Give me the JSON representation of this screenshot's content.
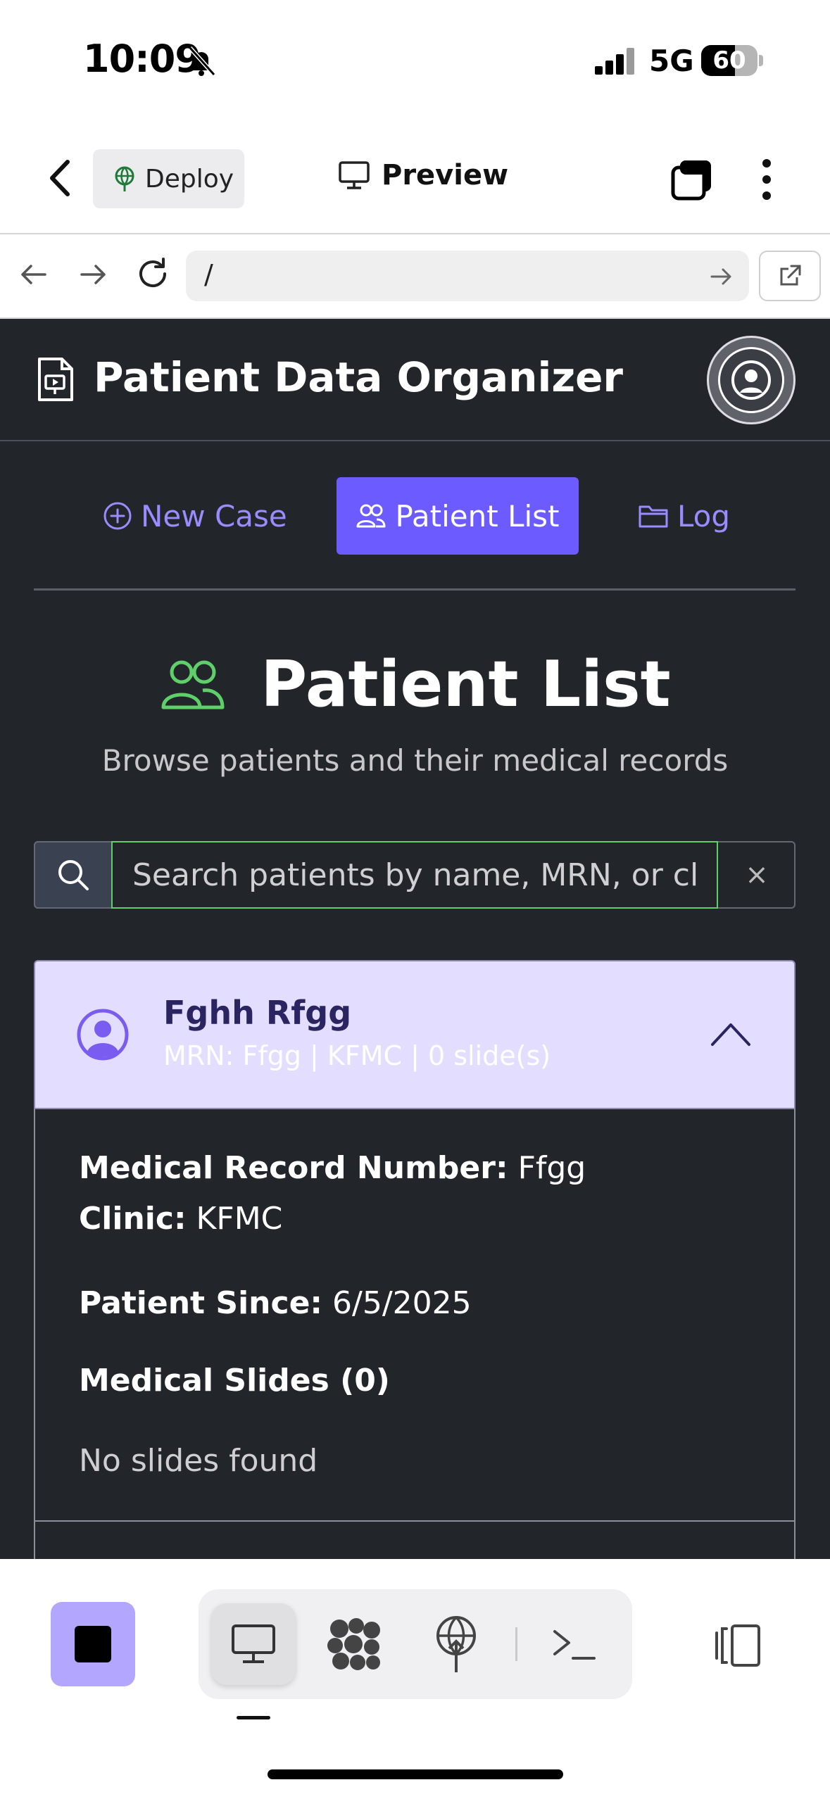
{
  "status_bar": {
    "time": "10:09",
    "network": "5G",
    "battery": "60",
    "battery_level": 0.6
  },
  "toolbar": {
    "deploy_label": "Deploy",
    "preview_label": "Preview"
  },
  "browser": {
    "url": "/"
  },
  "app": {
    "title": "Patient Data Organizer",
    "tabs": [
      {
        "label": "New Case",
        "icon": "plus-circle-icon"
      },
      {
        "label": "Patient List",
        "icon": "users-icon",
        "active": true
      },
      {
        "label": "Log",
        "icon": "folder-icon"
      }
    ],
    "page": {
      "title": "Patient List",
      "subtitle": "Browse patients and their medical records"
    },
    "search": {
      "placeholder": "Search patients by name, MRN, or clinic",
      "value": "",
      "clear_label": "×"
    },
    "patient": {
      "name": "Fghh Rfgg",
      "meta": "MRN: Ffgg | KFMC | 0 slide(s)",
      "mrn_label": "Medical Record Number:",
      "mrn_value": "Ffgg",
      "clinic_label": "Clinic:",
      "clinic_value": "KFMC",
      "since_label": "Patient Since:",
      "since_value": "6/5/2025",
      "slides_heading": "Medical Slides (0)",
      "slides_empty": "No slides found"
    }
  },
  "colors": {
    "app_bg": "#22252a",
    "accent": "#6c5cff",
    "accent_text": "#9a8cff",
    "success": "#5fcf6a",
    "card_header_bg": "#e3deff"
  },
  "bottom_bar": {
    "modes": [
      "desktop-icon",
      "apps-icon",
      "deploy-icon",
      "shell-icon"
    ],
    "active_mode": "desktop-icon"
  }
}
